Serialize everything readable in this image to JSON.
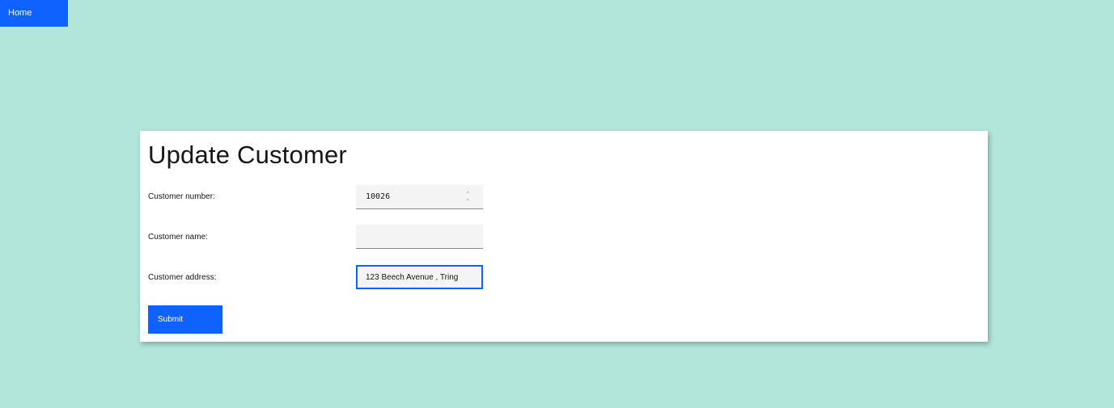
{
  "nav": {
    "home_label": "Home"
  },
  "form": {
    "title": "Update Customer",
    "fields": [
      {
        "label": "Customer number:",
        "value": "10026",
        "placeholder": ""
      },
      {
        "label": "Customer name:",
        "value": "",
        "placeholder": ""
      },
      {
        "label": "Customer address:",
        "value": "123 Beech Avenue , Tring",
        "placeholder": ""
      }
    ],
    "submit_label": "Submit"
  },
  "icons": {
    "stepper": "chevron-up-down-icon"
  },
  "colors": {
    "background": "#b2e6da",
    "primary": "#0f62fe",
    "card": "#ffffff",
    "input_bg": "#f4f4f4"
  }
}
